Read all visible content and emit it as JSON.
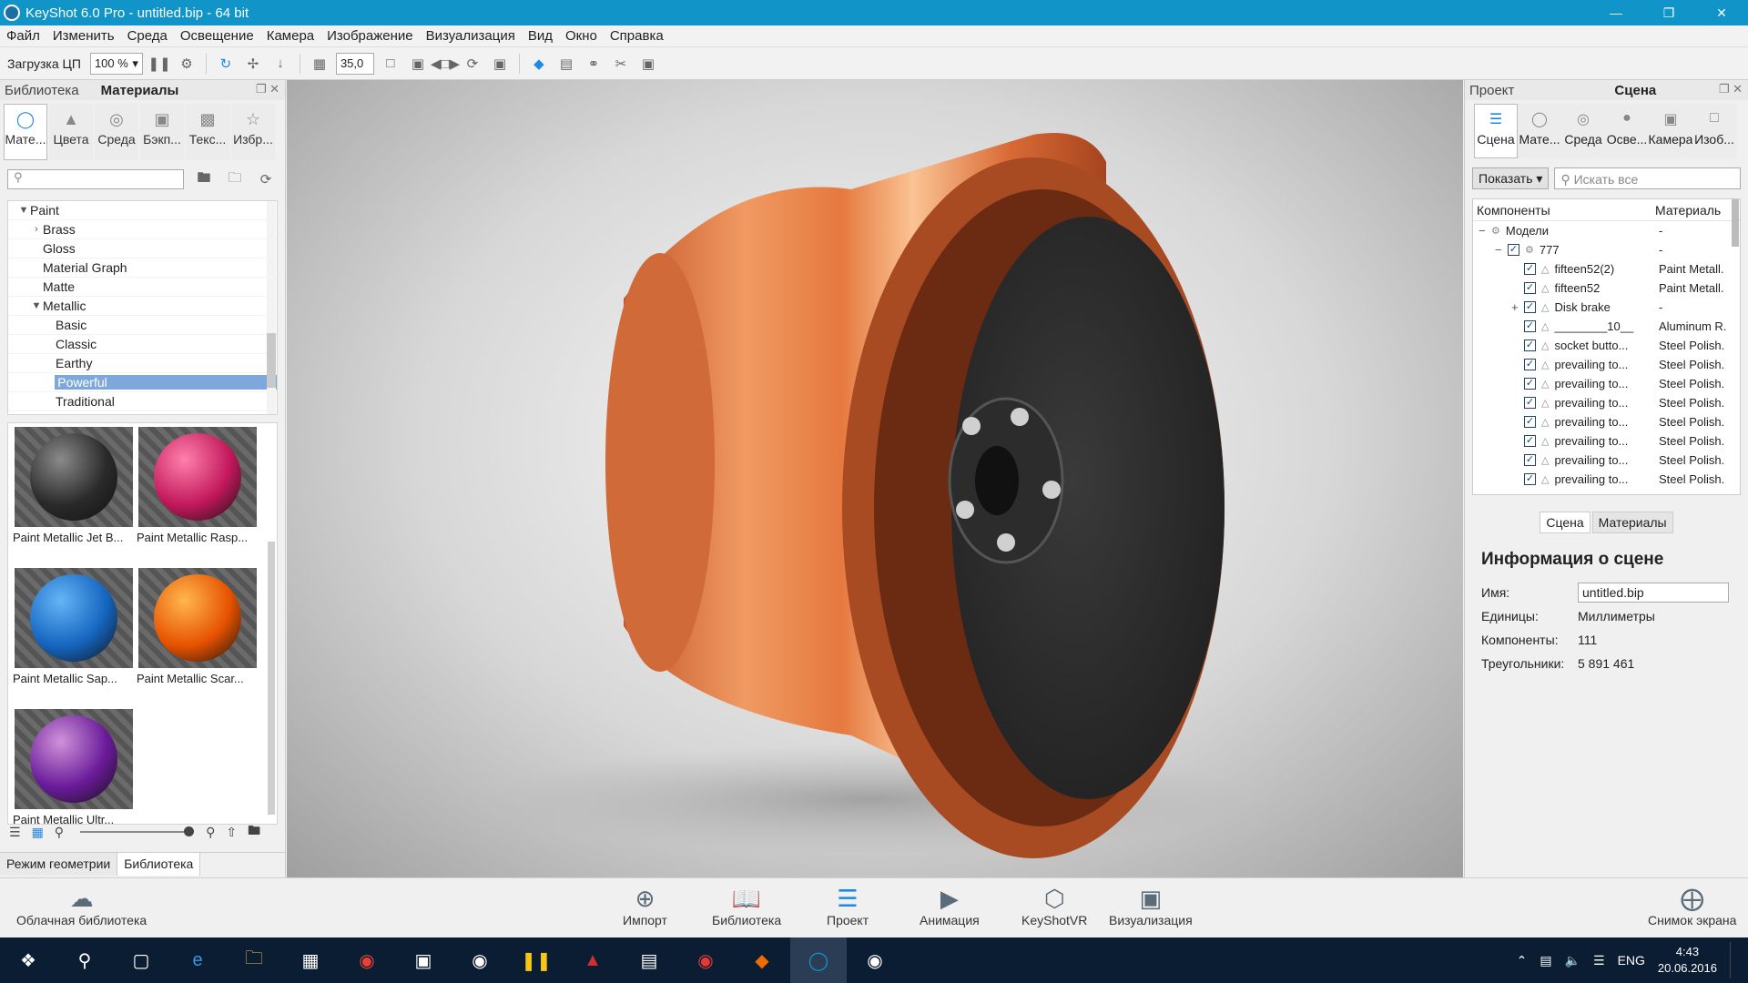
{
  "window": {
    "title": "KeyShot 6.0 Pro  - untitled.bip  - 64 bit"
  },
  "menu": [
    "Файл",
    "Изменить",
    "Среда",
    "Освещение",
    "Камера",
    "Изображение",
    "Визуализация",
    "Вид",
    "Окно",
    "Справка"
  ],
  "toolbar": {
    "cpu_label": "Загрузка ЦП",
    "cpu_value": "100 %",
    "fov_value": "35,0"
  },
  "left_panel": {
    "tab_library": "Библиотека",
    "tab_materials": "Материалы",
    "categories": [
      "Мате...",
      "Цвета",
      "Среда",
      "Бэкп...",
      "Текс...",
      "Избр..."
    ],
    "tree": [
      {
        "label": "Paint",
        "level": 0,
        "arrow": "▼"
      },
      {
        "label": "Brass",
        "level": 1,
        "arrow": "›"
      },
      {
        "label": "Gloss",
        "level": 1,
        "arrow": ""
      },
      {
        "label": "Material Graph",
        "level": 1,
        "arrow": ""
      },
      {
        "label": "Matte",
        "level": 1,
        "arrow": ""
      },
      {
        "label": "Metallic",
        "level": 1,
        "arrow": "▼"
      },
      {
        "label": "Basic",
        "level": 2,
        "arrow": ""
      },
      {
        "label": "Classic",
        "level": 2,
        "arrow": ""
      },
      {
        "label": "Earthy",
        "level": 2,
        "arrow": ""
      },
      {
        "label": "Powerful",
        "level": 2,
        "arrow": "",
        "selected": true
      },
      {
        "label": "Traditional",
        "level": 2,
        "arrow": ""
      }
    ],
    "materials": [
      {
        "label": "Paint Metallic Jet B...",
        "color": "#2a2a2a",
        "hi": "#8a8a8a"
      },
      {
        "label": "Paint Metallic Rasp...",
        "color": "#c2185b",
        "hi": "#ff80ab"
      },
      {
        "label": "Paint Metallic Sap...",
        "color": "#1565c0",
        "hi": "#64b5f6"
      },
      {
        "label": "Paint Metallic Scar...",
        "color": "#e65100",
        "hi": "#ffb74d"
      },
      {
        "label": "Paint Metallic Ultr...",
        "color": "#6a1b9a",
        "hi": "#ce93d8"
      }
    ],
    "mode_tabs": [
      "Режим геометрии",
      "Библиотека"
    ]
  },
  "right_panel": {
    "tab_project": "Проект",
    "tab_scene": "Сцена",
    "tabs": [
      "Сцена",
      "Мате...",
      "Среда",
      "Осве...",
      "Камера",
      "Изоб..."
    ],
    "show_button": "Показать",
    "search_placeholder": "Искать все",
    "col_components": "Компоненты",
    "col_materials": "Материаль",
    "rows": [
      {
        "name": "Модели",
        "material": "-",
        "indent": 0,
        "exp": "−",
        "cb": false
      },
      {
        "name": "777",
        "material": "-",
        "indent": 1,
        "exp": "−",
        "cb": true
      },
      {
        "name": "fifteen52(2)",
        "material": "Paint Metall.",
        "indent": 2,
        "exp": "",
        "cb": true
      },
      {
        "name": "fifteen52",
        "material": "Paint Metall.",
        "indent": 2,
        "exp": "",
        "cb": true
      },
      {
        "name": "Disk brake",
        "material": "-",
        "indent": 2,
        "exp": "+",
        "cb": true
      },
      {
        "name": "________10__",
        "material": "Aluminum R.",
        "indent": 2,
        "exp": "",
        "cb": true
      },
      {
        "name": "socket butto...",
        "material": "Steel Polish.",
        "indent": 2,
        "exp": "",
        "cb": true
      },
      {
        "name": "prevailing to...",
        "material": "Steel Polish.",
        "indent": 2,
        "exp": "",
        "cb": true
      },
      {
        "name": "prevailing to...",
        "material": "Steel Polish.",
        "indent": 2,
        "exp": "",
        "cb": true
      },
      {
        "name": "prevailing to...",
        "material": "Steel Polish.",
        "indent": 2,
        "exp": "",
        "cb": true
      },
      {
        "name": "prevailing to...",
        "material": "Steel Polish.",
        "indent": 2,
        "exp": "",
        "cb": true
      },
      {
        "name": "prevailing to...",
        "material": "Steel Polish.",
        "indent": 2,
        "exp": "",
        "cb": true
      },
      {
        "name": "prevailing to...",
        "material": "Steel Polish.",
        "indent": 2,
        "exp": "",
        "cb": true
      },
      {
        "name": "prevailing to...",
        "material": "Steel Polish.",
        "indent": 2,
        "exp": "",
        "cb": true
      }
    ],
    "info_tabs": [
      "Сцена",
      "Материалы"
    ],
    "info_title": "Информация о сцене",
    "name_label": "Имя:",
    "name_value": "untitled.bip",
    "units_label": "Единицы:",
    "units_value": "Миллиметры",
    "components_label": "Компоненты:",
    "components_value": "111",
    "triangles_label": "Треугольники:",
    "triangles_value": "5 891 461"
  },
  "bottom_bar": {
    "cloud": "Облачная библиотека",
    "import": "Импорт",
    "library": "Библиотека",
    "project": "Проект",
    "animation": "Анимация",
    "keyshotvr": "KeyShotVR",
    "render": "Визуализация",
    "screenshot": "Снимок экрана"
  },
  "taskbar": {
    "lang": "ENG",
    "time": "4:43",
    "date": "20.06.2016"
  }
}
